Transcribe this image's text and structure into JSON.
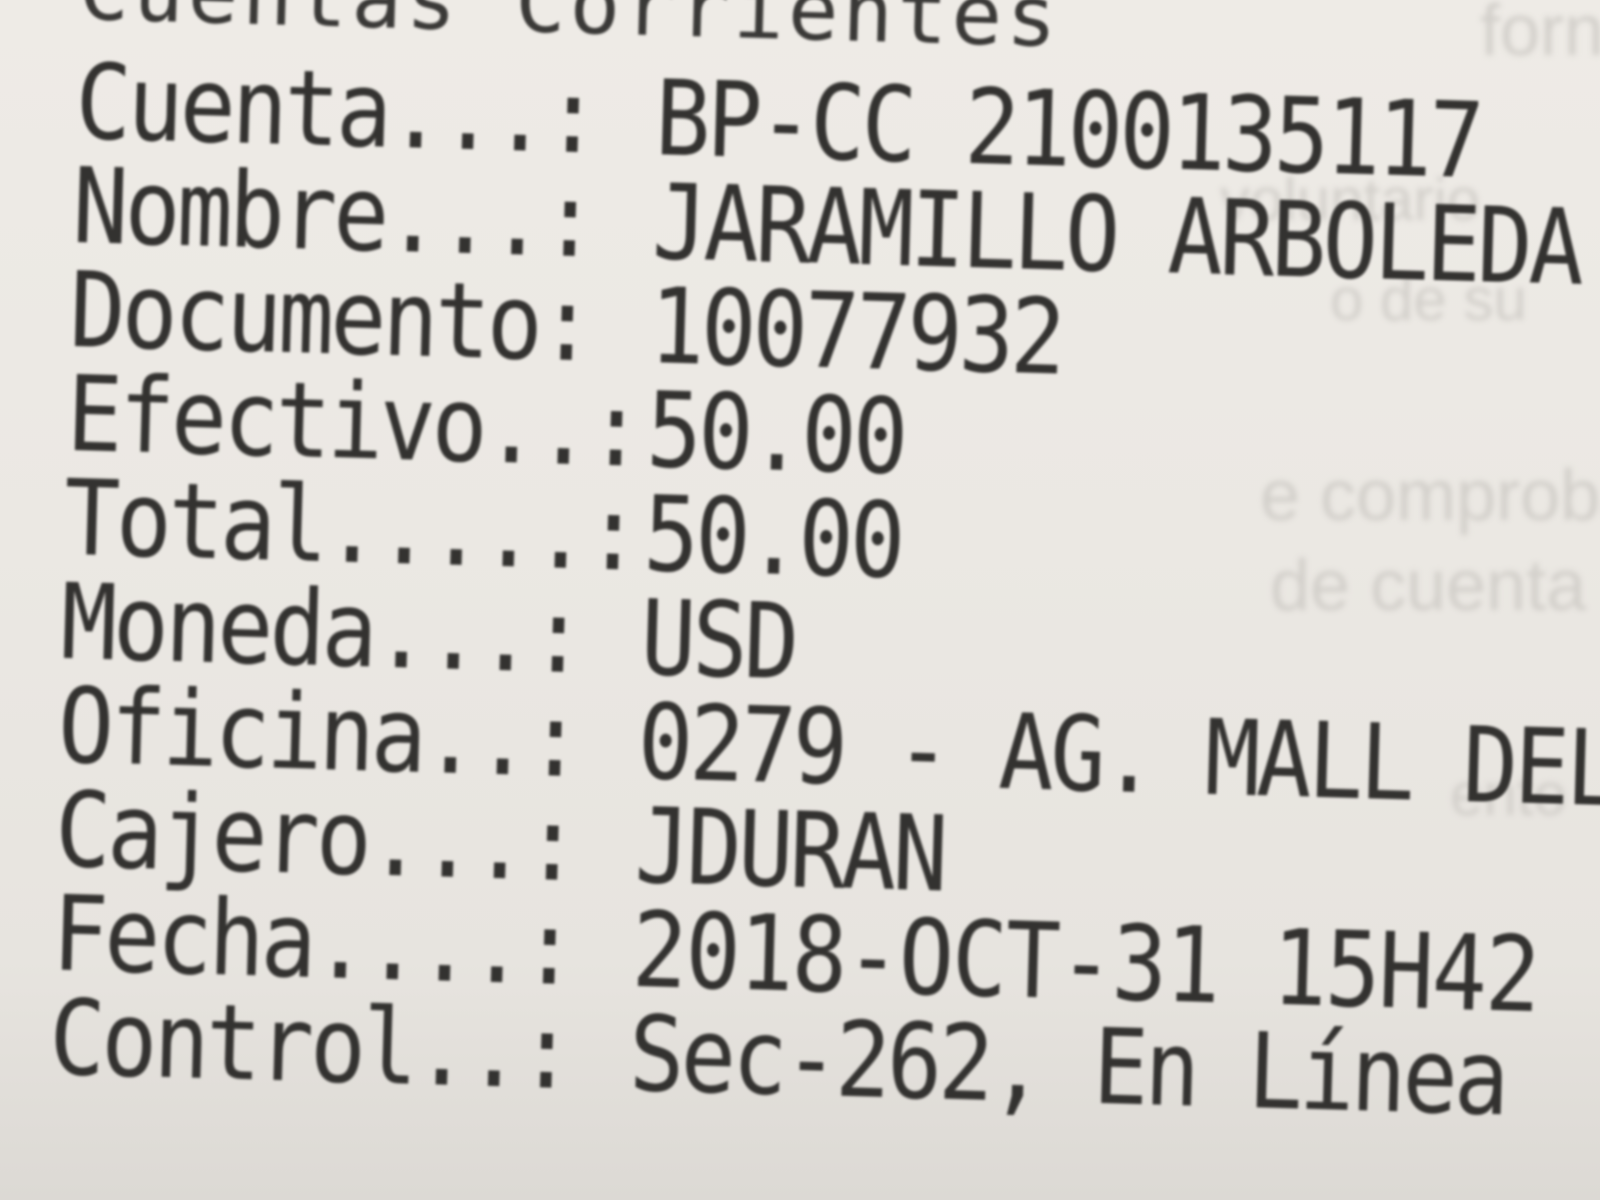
{
  "heading": "Cuentas Corrientes",
  "fields": [
    {
      "label": "Cuenta...:",
      "value": "BP-CC 2100135117"
    },
    {
      "label": "Nombre...:",
      "value": "JARAMILLO ARBOLEDA"
    },
    {
      "label": "Documento:",
      "value": "10077932"
    },
    {
      "label": "Efectivo..:",
      "value": "50.00"
    },
    {
      "label": "Total.....:",
      "value": "50.00"
    },
    {
      "label": "Moneda...:",
      "value": "USD"
    },
    {
      "label": "Oficina..:",
      "value": "0279 - AG. MALL DEL"
    },
    {
      "label": "Cajero...:",
      "value": "JDURAN"
    },
    {
      "label": "Fecha....:",
      "value": "2018-OCT-31  15H42"
    },
    {
      "label": "Control..:",
      "value": "Sec-262, En Línea"
    }
  ],
  "bleed_through": [
    "e comprobante las",
    "de cuenta",
    "forn",
    "voluntario",
    "o de su",
    "ento"
  ]
}
